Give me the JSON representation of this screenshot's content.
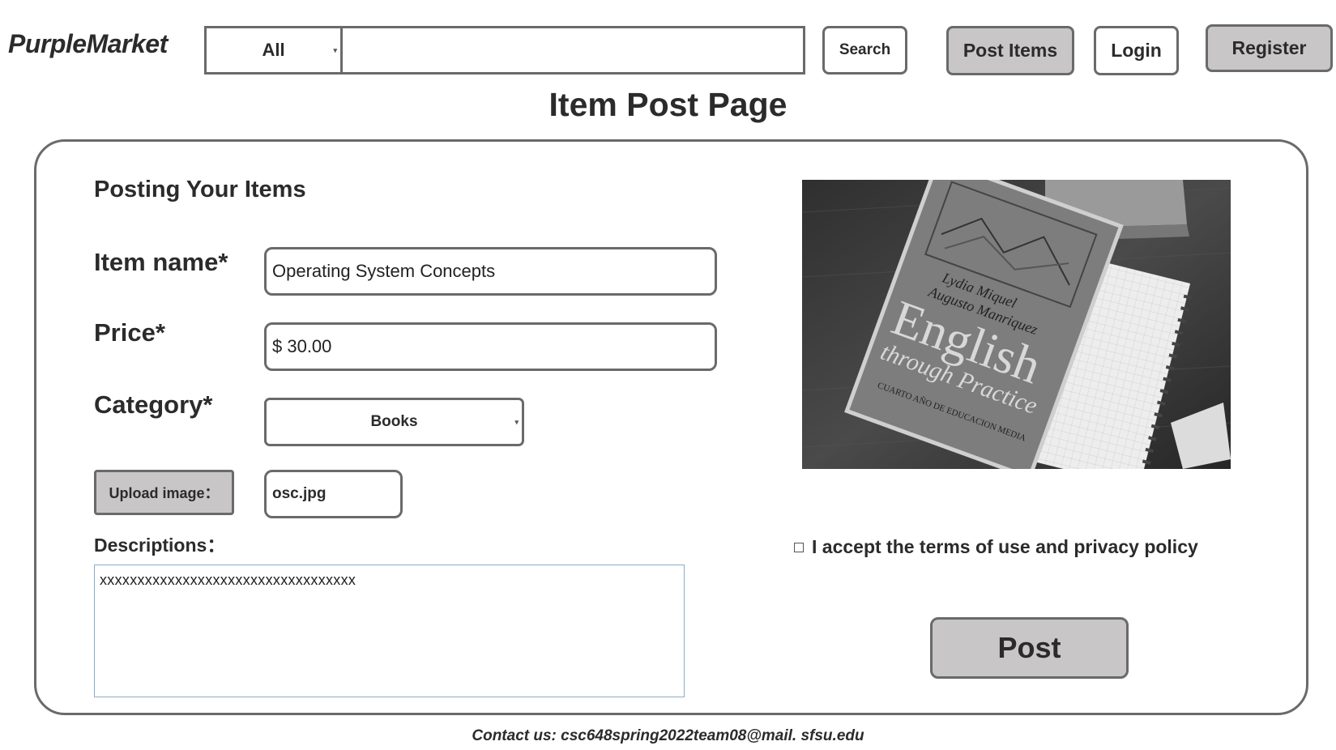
{
  "header": {
    "logo": "PurpleMarket",
    "category_select": "All",
    "search_query": "",
    "search_button": "Search",
    "post_items_button": "Post Items",
    "login_button": "Login",
    "register_button": "Register"
  },
  "page_title": "Item Post Page",
  "form": {
    "heading": "Posting Your Items",
    "item_name_label": "Item name*",
    "item_name_value": "Operating System Concepts",
    "price_label": "Price*",
    "price_value": "$ 30.00",
    "category_label": "Category*",
    "category_value": "Books",
    "upload_button": "Upload image：",
    "file_name": "osc.jpg",
    "descriptions_label": "Descriptions：",
    "descriptions_value": "xxxxxxxxxxxxxxxxxxxxxxxxxxxxxxxxxx"
  },
  "preview_image": {
    "author_line1": "Lydia Miquel",
    "author_line2": "Augusto Manriquez",
    "title_word1": "English",
    "title_word2": "through Practice",
    "subtitle": "CUARTO AÑO DE EDUCACION MEDIA"
  },
  "terms": {
    "checked": false,
    "label": "I accept the terms of use and privacy policy"
  },
  "post_button": "Post",
  "footer": "Contact us: csc648spring2022team08@mail. sfsu.edu"
}
